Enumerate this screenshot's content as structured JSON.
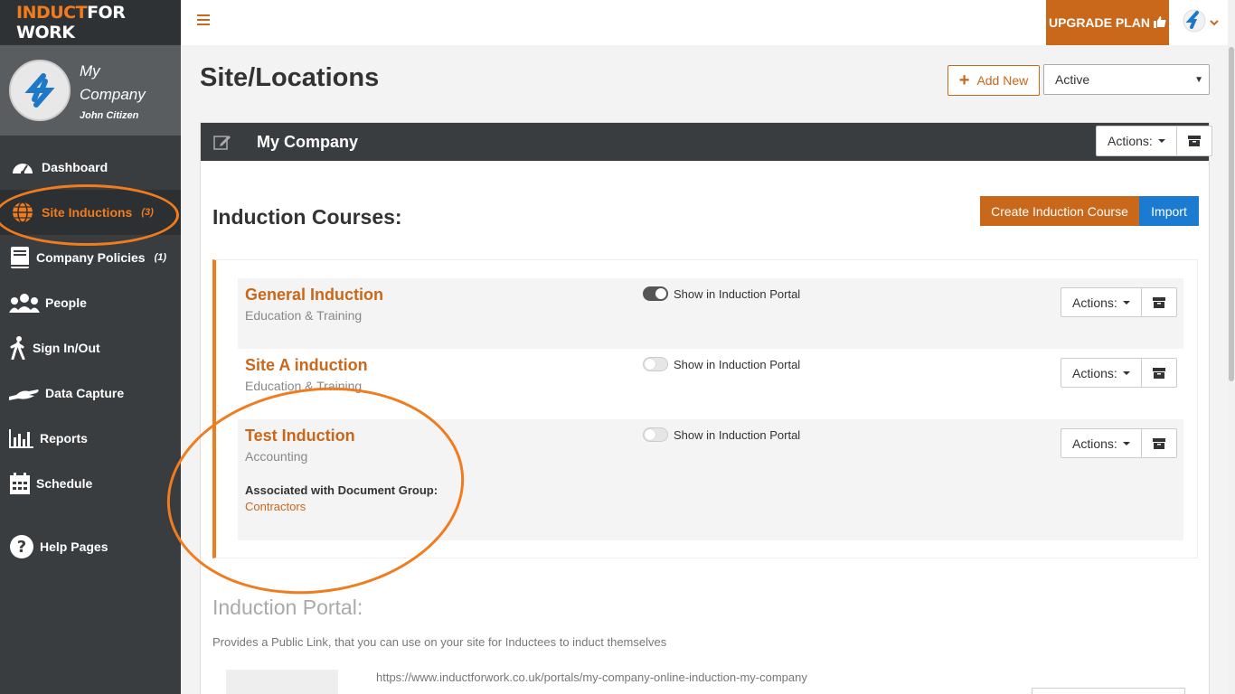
{
  "brand": {
    "part1": "INDUCT",
    "part2": "FOR WORK"
  },
  "company": {
    "name_line1": "My",
    "name_line2": "Company",
    "user": "John Citizen"
  },
  "nav": [
    {
      "label": "Dashboard",
      "count": "",
      "icon": "speedometer-icon"
    },
    {
      "label": "Site Inductions",
      "count": "(3)",
      "icon": "globe-icon"
    },
    {
      "label": "Company Policies",
      "count": "(1)",
      "icon": "book-icon"
    },
    {
      "label": "People",
      "count": "",
      "icon": "people-icon"
    },
    {
      "label": "Sign In/Out",
      "count": "",
      "icon": "walking-icon"
    },
    {
      "label": "Data Capture",
      "count": "",
      "icon": "hand-icon"
    },
    {
      "label": "Reports",
      "count": "",
      "icon": "bar-chart-icon"
    },
    {
      "label": "Schedule",
      "count": "",
      "icon": "calendar-icon"
    },
    {
      "label": "Help Pages",
      "count": "",
      "icon": "question-icon"
    }
  ],
  "topbar": {
    "upgrade_label": "UPGRADE PLAN"
  },
  "page": {
    "title": "Site/Locations",
    "add_new_label": "Add New",
    "status_value": "Active"
  },
  "panel": {
    "name": "My Company",
    "actions_label": "Actions:"
  },
  "courses": {
    "title": "Induction Courses:",
    "create_label": "Create Induction Course",
    "import_label": "Import",
    "toggle_label": "Show in Induction Portal",
    "actions_label": "Actions:",
    "items": [
      {
        "name": "General Induction",
        "category": "Education & Training",
        "portal": true
      },
      {
        "name": "Site A induction",
        "category": "Education & Training",
        "portal": false
      },
      {
        "name": "Test Induction",
        "category": "Accounting",
        "portal": false,
        "assoc_label": "Associated with Document Group:",
        "assoc_value": "Contractors"
      }
    ]
  },
  "portal": {
    "title": "Induction Portal:",
    "description": "Provides a Public Link, that you can use on your site for Inductees to induct themselves",
    "url": "https://www.inductforwork.co.uk/portals/my-company-online-induction-my-company"
  },
  "colors": {
    "accent": "#c9671b",
    "highlight": "#f07c1e",
    "sidebar": "#3a3d40",
    "import": "#1a7bd1"
  }
}
